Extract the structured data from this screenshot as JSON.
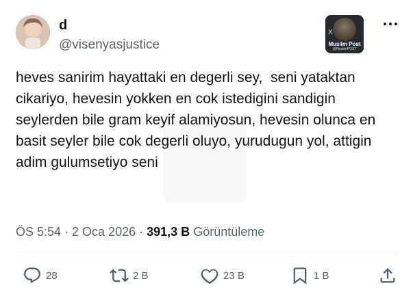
{
  "author": {
    "display_name": "d",
    "handle": "@visenyasjustice"
  },
  "badge": {
    "title": "Muslim Post",
    "subtitle": "@MuslimPOST",
    "x_mark": "X"
  },
  "menu": {
    "icon": "more-horizontal-icon"
  },
  "tweet": {
    "text": "heves sanirim hayattaki en degerli sey,  seni yataktan cikariyo, hevesin yokken en cok istedigini sandigin seylerden bile gram keyif alamiyosun, hevesin olunca en basit seyler bile cok degerli oluyo, yurudugun yol, attigin adim gulumsetiyo seni"
  },
  "meta": {
    "time": "ÖS 5:54",
    "separator": " · ",
    "date": "2 Oca 2026",
    "views_count": "391,3 B",
    "views_label": "Görüntüleme"
  },
  "actions": {
    "reply": {
      "icon": "reply-icon",
      "count": "28"
    },
    "retweet": {
      "icon": "retweet-icon",
      "count": "2 B"
    },
    "like": {
      "icon": "heart-icon",
      "count": "23 B"
    },
    "bookmark": {
      "icon": "bookmark-icon",
      "count": "1 B"
    },
    "share": {
      "icon": "share-icon"
    }
  },
  "colors": {
    "text_primary": "#0f1419",
    "text_secondary": "#536471",
    "divider": "#eff3f4"
  }
}
